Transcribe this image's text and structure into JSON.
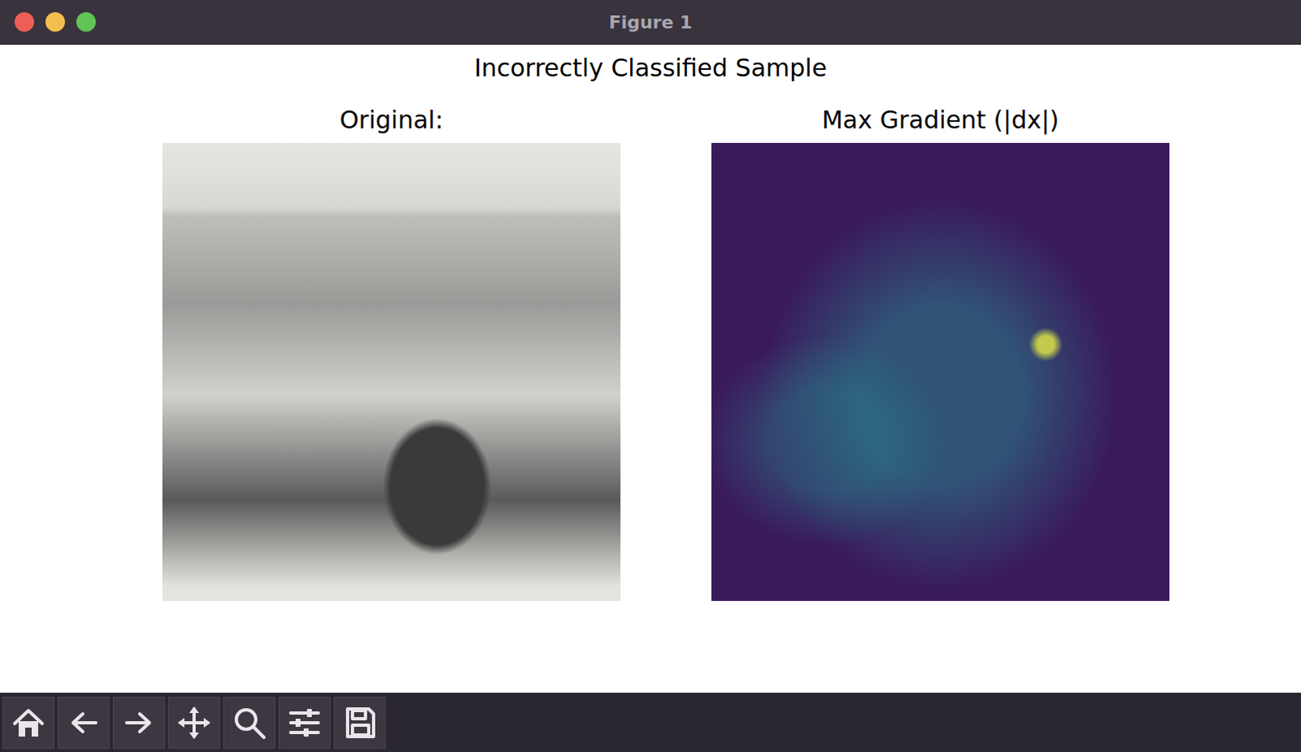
{
  "window": {
    "title": "Figure 1"
  },
  "figure": {
    "title": "Incorrectly Classified Sample",
    "subplots": [
      {
        "title": "Original:"
      },
      {
        "title": "Max Gradient (|dx|)"
      }
    ]
  }
}
